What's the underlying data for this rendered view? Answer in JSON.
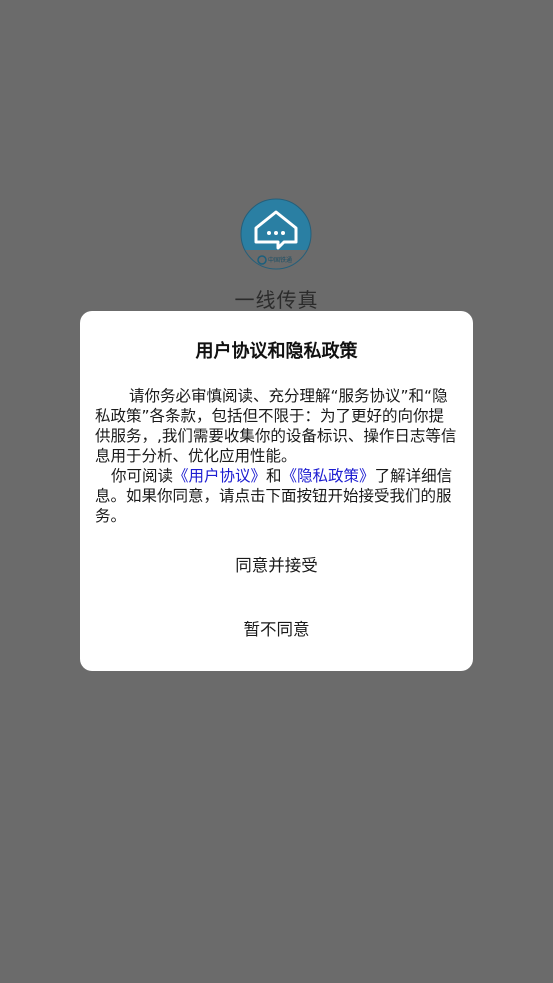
{
  "splash": {
    "app_name": "一线传真",
    "logo_text": "中国铁通"
  },
  "dialog": {
    "title": "用户协议和隐私政策",
    "para1": "请你务必审慎阅读、充分理解“服务协议”和“隐私政策”各条款，包括但不限于：为了更好的向你提供服务，,我们需要收集你的设备标识、操作日志等信息用于分析、优化应用性能。",
    "para2_prefix": "你可阅读",
    "user_agreement_link": "《用户协议》",
    "para2_and": "和",
    "privacy_policy_link": "《隐私政策》",
    "para2_suffix": "了解详细信息。如果你同意，请点击下面按钮开始接受我们的服务。",
    "agree_button": "同意并接受",
    "decline_button": "暂不同意"
  },
  "colors": {
    "overlay": "#6b6b6b",
    "dialog_bg": "#ffffff",
    "link": "#1c1cd1",
    "logo_blue": "#2a7fa3"
  }
}
